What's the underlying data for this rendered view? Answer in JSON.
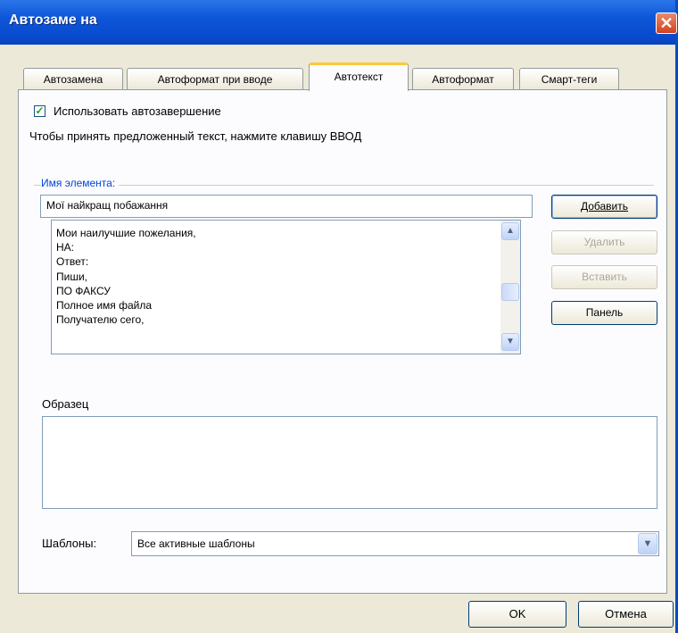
{
  "window": {
    "title": "Автозаме на",
    "close_glyph": "✕"
  },
  "tabs": [
    {
      "label": "Автозамена"
    },
    {
      "label": "Автоформат при вводе"
    },
    {
      "label": "Автотекст"
    },
    {
      "label": "Автоформат"
    },
    {
      "label": "Смарт-теги"
    }
  ],
  "active_tab": "Автотекст",
  "autocomplete": {
    "checked": true,
    "label": "Использовать автозавершение",
    "hint": "Чтобы принять предложенный текст, нажмите клавишу ВВОД"
  },
  "element_group": {
    "label": "Имя элемента:",
    "value": "Мої найкращ побажання"
  },
  "entries": [
    "Мои наилучшие пожелания,",
    "НА:",
    "Ответ:",
    "Пиши,",
    "ПО ФАКСУ",
    "Полное имя файла",
    "Получателю сего,"
  ],
  "buttons": {
    "add": "Добавить",
    "delete": "Удалить",
    "insert": "Вставить",
    "toolbar": "Панель",
    "ok": "OK",
    "cancel": "Отмена"
  },
  "sample_label": "Образец",
  "templates": {
    "label": "Шаблоны:",
    "value": "Все активные шаблоны"
  },
  "icons": {
    "check": "check-icon",
    "scroll_up": "arrow-up-icon",
    "scroll_down": "arrow-down-icon",
    "dropdown": "chevron-down-icon",
    "close": "close-icon"
  },
  "colors": {
    "title_bar": "#0a4bd0",
    "active_tab_accent": "#ffc83c",
    "group_label": "#0046d5",
    "checkmark": "#21a121"
  }
}
